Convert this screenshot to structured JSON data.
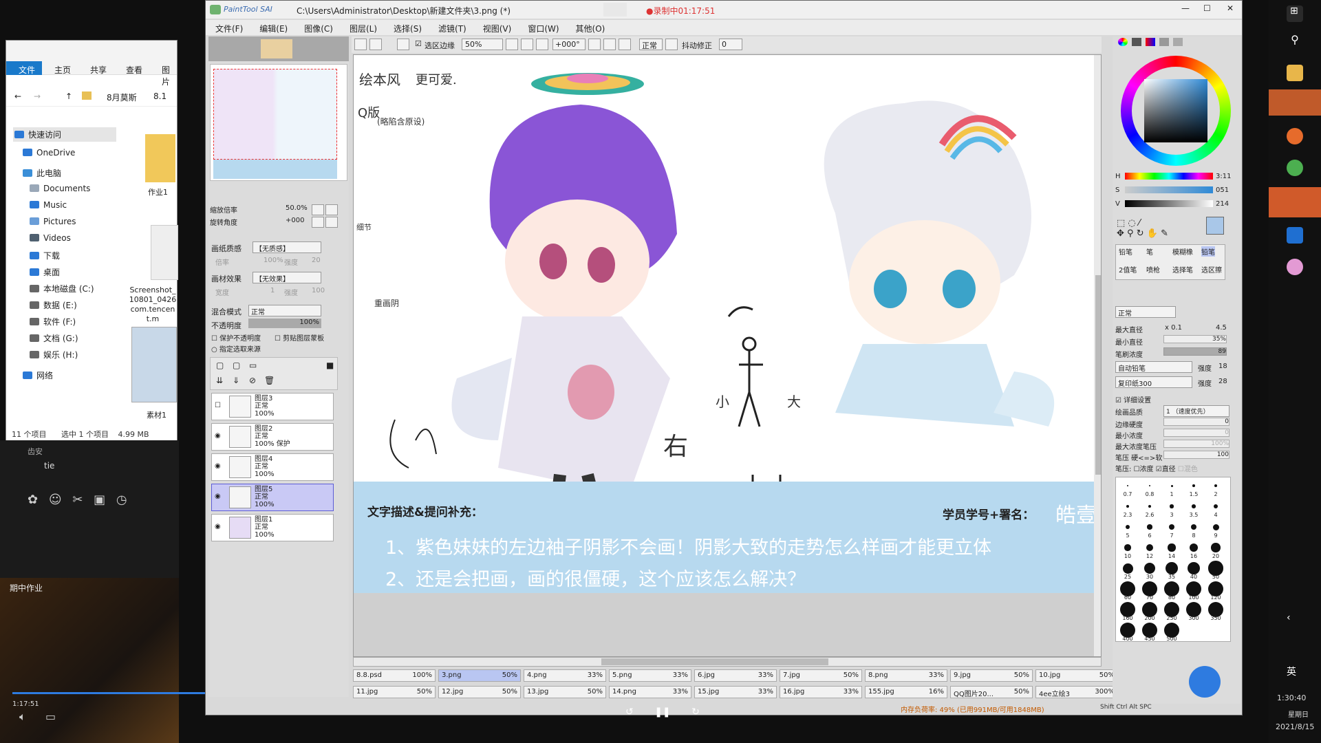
{
  "explorer": {
    "ribbon_tabs": [
      "文件",
      "主页",
      "共享",
      "查看",
      "图片"
    ],
    "path": [
      "8月莫斯",
      "8.1"
    ],
    "tree": [
      "快速访问",
      "OneDrive",
      "此电脑",
      "Documents",
      "Music",
      "Pictures",
      "Videos",
      "下载",
      "桌面",
      "本地磁盘 (C:)",
      "数据 (E:)",
      "软件 (F:)",
      "文档 (G:)",
      "娱乐 (H:)",
      "网络"
    ],
    "files": [
      {
        "name": "作业1"
      },
      {
        "name": "Screenshot_10801_0426com.tencent.m"
      },
      {
        "name": "素材1"
      }
    ],
    "status": {
      "count": "11 个项目",
      "selected": "选中 1 个项目",
      "size": "4.99 MB"
    }
  },
  "chat": {
    "name1": "齿安",
    "name2": "tie",
    "video_title": "期中作业",
    "time_current": "1:17:51"
  },
  "sai": {
    "app_logo": "PaintTool SAI",
    "title": "C:\\Users\\Administrator\\Desktop\\新建文件夹\\3.png (*)",
    "record": "●录制中01:17:51",
    "menu": [
      "文件(F)",
      "编辑(E)",
      "图像(C)",
      "图层(L)",
      "选择(S)",
      "滤镜(T)",
      "视图(V)",
      "窗口(W)",
      "其他(O)"
    ],
    "toolbar": {
      "select_edge": "选区边缘",
      "zoom": "50%",
      "rotate": "+000°",
      "mode": "正常",
      "stabilizer_label": "抖动修正",
      "stabilizer": "0"
    },
    "nav": {
      "zoom_label": "缩放倍率",
      "zoom": "50.0%",
      "rotate_label": "旋转角度",
      "rotate": "+000"
    },
    "paper": {
      "label": "画纸质感",
      "value": "【无质感】",
      "effect_label": "画材效果",
      "effect_value": "【无效果】",
      "sub1": "倍率",
      "sub1v": "100%",
      "sub2": "强度",
      "sub2v": "20",
      "sub3": "宽度",
      "sub3v": "1",
      "sub4": "强度",
      "sub4v": "100"
    },
    "blend": {
      "label": "混合模式",
      "value": "正常",
      "opacity_label": "不透明度",
      "opacity": "100%",
      "protect": "保护不透明度",
      "clip": "剪贴图层蒙板",
      "source": "指定选取来源"
    },
    "layers": [
      {
        "name": "图层3",
        "mode": "正常",
        "opacity": "100%"
      },
      {
        "name": "图层2",
        "mode": "正常",
        "opacity": "100% 保护"
      },
      {
        "name": "图层4",
        "mode": "正常",
        "opacity": "100%"
      },
      {
        "name": "图层5",
        "mode": "正常",
        "opacity": "100%"
      },
      {
        "name": "图层1",
        "mode": "正常",
        "opacity": "100%"
      }
    ],
    "color": {
      "h_label": "H",
      "h": "3:11",
      "s_label": "S",
      "s": "051",
      "v_label": "V",
      "v": "214"
    },
    "tools": [
      "铅笔",
      "笔",
      "模糊橡",
      "铅笔",
      "2值笔",
      "喷枪",
      "选择笔",
      "选区擦"
    ],
    "brush": {
      "mode": "正常",
      "max_label": "最大直径",
      "max_mult": "x 0.1",
      "max": "4.5",
      "min_label": "最小直径",
      "min": "35%",
      "density_label": "笔刷浓度",
      "density": "89",
      "shape": "自动铅笔",
      "shape_strength_label": "强度",
      "shape_strength": "18",
      "texture": "复印纸300",
      "texture_strength_label": "强度",
      "texture_strength": "28",
      "detail": "详细设置",
      "quality_label": "绘画品质",
      "quality": "1 （速度优先）",
      "edge_label": "边缘硬度",
      "edge": "0",
      "minden_label": "最小浓度",
      "minden": "0",
      "maxpress_label": "最大浓度笔压",
      "maxpress": "100%",
      "hardsoft_label": "笔压 硬<=>软",
      "hardsoft": "100",
      "pressure_label": "笔压:",
      "p_density": "浓度",
      "p_diameter": "直径",
      "p_blend": "混色"
    },
    "sizes": [
      "0.7",
      "0.8",
      "1",
      "1.5",
      "2",
      "2.3",
      "2.6",
      "3",
      "3.5",
      "4",
      "5",
      "6",
      "7",
      "8",
      "9",
      "10",
      "12",
      "14",
      "16",
      "20",
      "25",
      "30",
      "35",
      "40",
      "50",
      "60",
      "70",
      "80",
      "100",
      "120",
      "160",
      "200",
      "250",
      "300",
      "350",
      "400",
      "450",
      "500"
    ],
    "tabs_row1": [
      {
        "name": "8.8.psd",
        "zoom": "100%"
      },
      {
        "name": "3.png",
        "zoom": "50%"
      },
      {
        "name": "4.png",
        "zoom": "33%"
      },
      {
        "name": "5.png",
        "zoom": "33%"
      },
      {
        "name": "6.jpg",
        "zoom": "33%"
      },
      {
        "name": "7.jpg",
        "zoom": "50%"
      },
      {
        "name": "8.png",
        "zoom": "33%"
      },
      {
        "name": "9.jpg",
        "zoom": "50%"
      },
      {
        "name": "10.jpg",
        "zoom": "50%"
      }
    ],
    "tabs_row2": [
      {
        "name": "11.jpg",
        "zoom": "50%"
      },
      {
        "name": "12.jpg",
        "zoom": "50%"
      },
      {
        "name": "13.jpg",
        "zoom": "50%"
      },
      {
        "name": "14.png",
        "zoom": "33%"
      },
      {
        "name": "15.jpg",
        "zoom": "33%"
      },
      {
        "name": "16.jpg",
        "zoom": "33%"
      },
      {
        "name": "155.jpg",
        "zoom": "16%"
      },
      {
        "name": "QQ图片20...",
        "zoom": "50%"
      },
      {
        "name": "4ee立绘3",
        "zoom": "300%"
      }
    ],
    "status_mem": "内存负荷率: 49% (已用991MB/可用1848MB)",
    "status_keys": "Shift Ctrl Alt SPC"
  },
  "canvas": {
    "notes": [
      "绘本风",
      "更可爱.",
      "Q版",
      "(略陷含原设)",
      "细节",
      "重画阴",
      "小",
      "大",
      "右"
    ],
    "label_desc": "文字描述&提问补充：",
    "label_student": "学员学号+署名：",
    "student_name": "皓壹",
    "q1": "1、紫色妹妹的左边袖子阴影不会画！阴影大致的走势怎么样画才能更立体",
    "q2": "2、还是会把画，画的很僵硬，这个应该怎么解决？"
  },
  "taskbar": {
    "lang": "英",
    "time": "1:30:40",
    "date": "2021/8/15",
    "weekday": "星期日"
  },
  "colors": {
    "accent": "#0078d7",
    "canvas_band": "#b7d9ef"
  }
}
